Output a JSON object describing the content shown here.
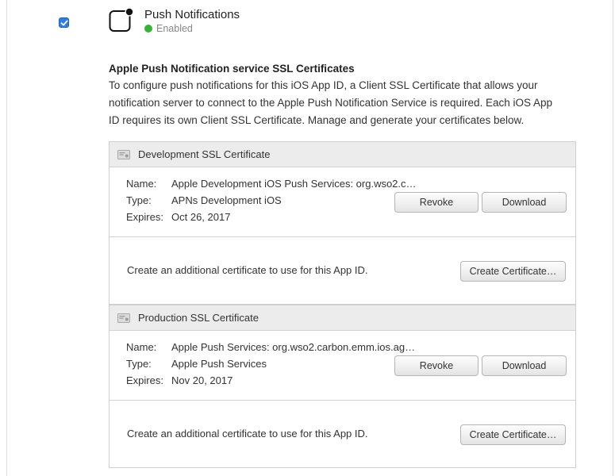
{
  "service": {
    "title": "Push Notifications",
    "status": "Enabled",
    "status_color": "#33b533",
    "icon": "push-notification-icon"
  },
  "section": {
    "heading": "Apple Push Notification service SSL Certificates",
    "description": "To configure push notifications for this iOS App ID, a Client SSL Certificate that allows your notification server to connect to the Apple Push Notification Service is required. Each iOS App ID requires its own Client SSL Certificate. Manage and generate your certificates below."
  },
  "labels": {
    "name": "Name:",
    "type": "Type:",
    "expires": "Expires:"
  },
  "development": {
    "title": "Development SSL Certificate",
    "name": "Apple Development iOS Push Services: org.wso2.c…",
    "type": "APNs Development iOS",
    "expires": "Oct 26, 2017",
    "revoke_label": "Revoke",
    "download_label": "Download",
    "create_text": "Create an additional certificate to use for this App ID.",
    "create_label": "Create Certificate…"
  },
  "production": {
    "title": "Production SSL Certificate",
    "name": "Apple Push Services: org.wso2.carbon.emm.ios.ag…",
    "type": "Apple Push Services",
    "expires": "Nov 20, 2017",
    "revoke_label": "Revoke",
    "download_label": "Download",
    "create_text": "Create an additional certificate to use for this App ID.",
    "create_label": "Create Certificate…"
  }
}
